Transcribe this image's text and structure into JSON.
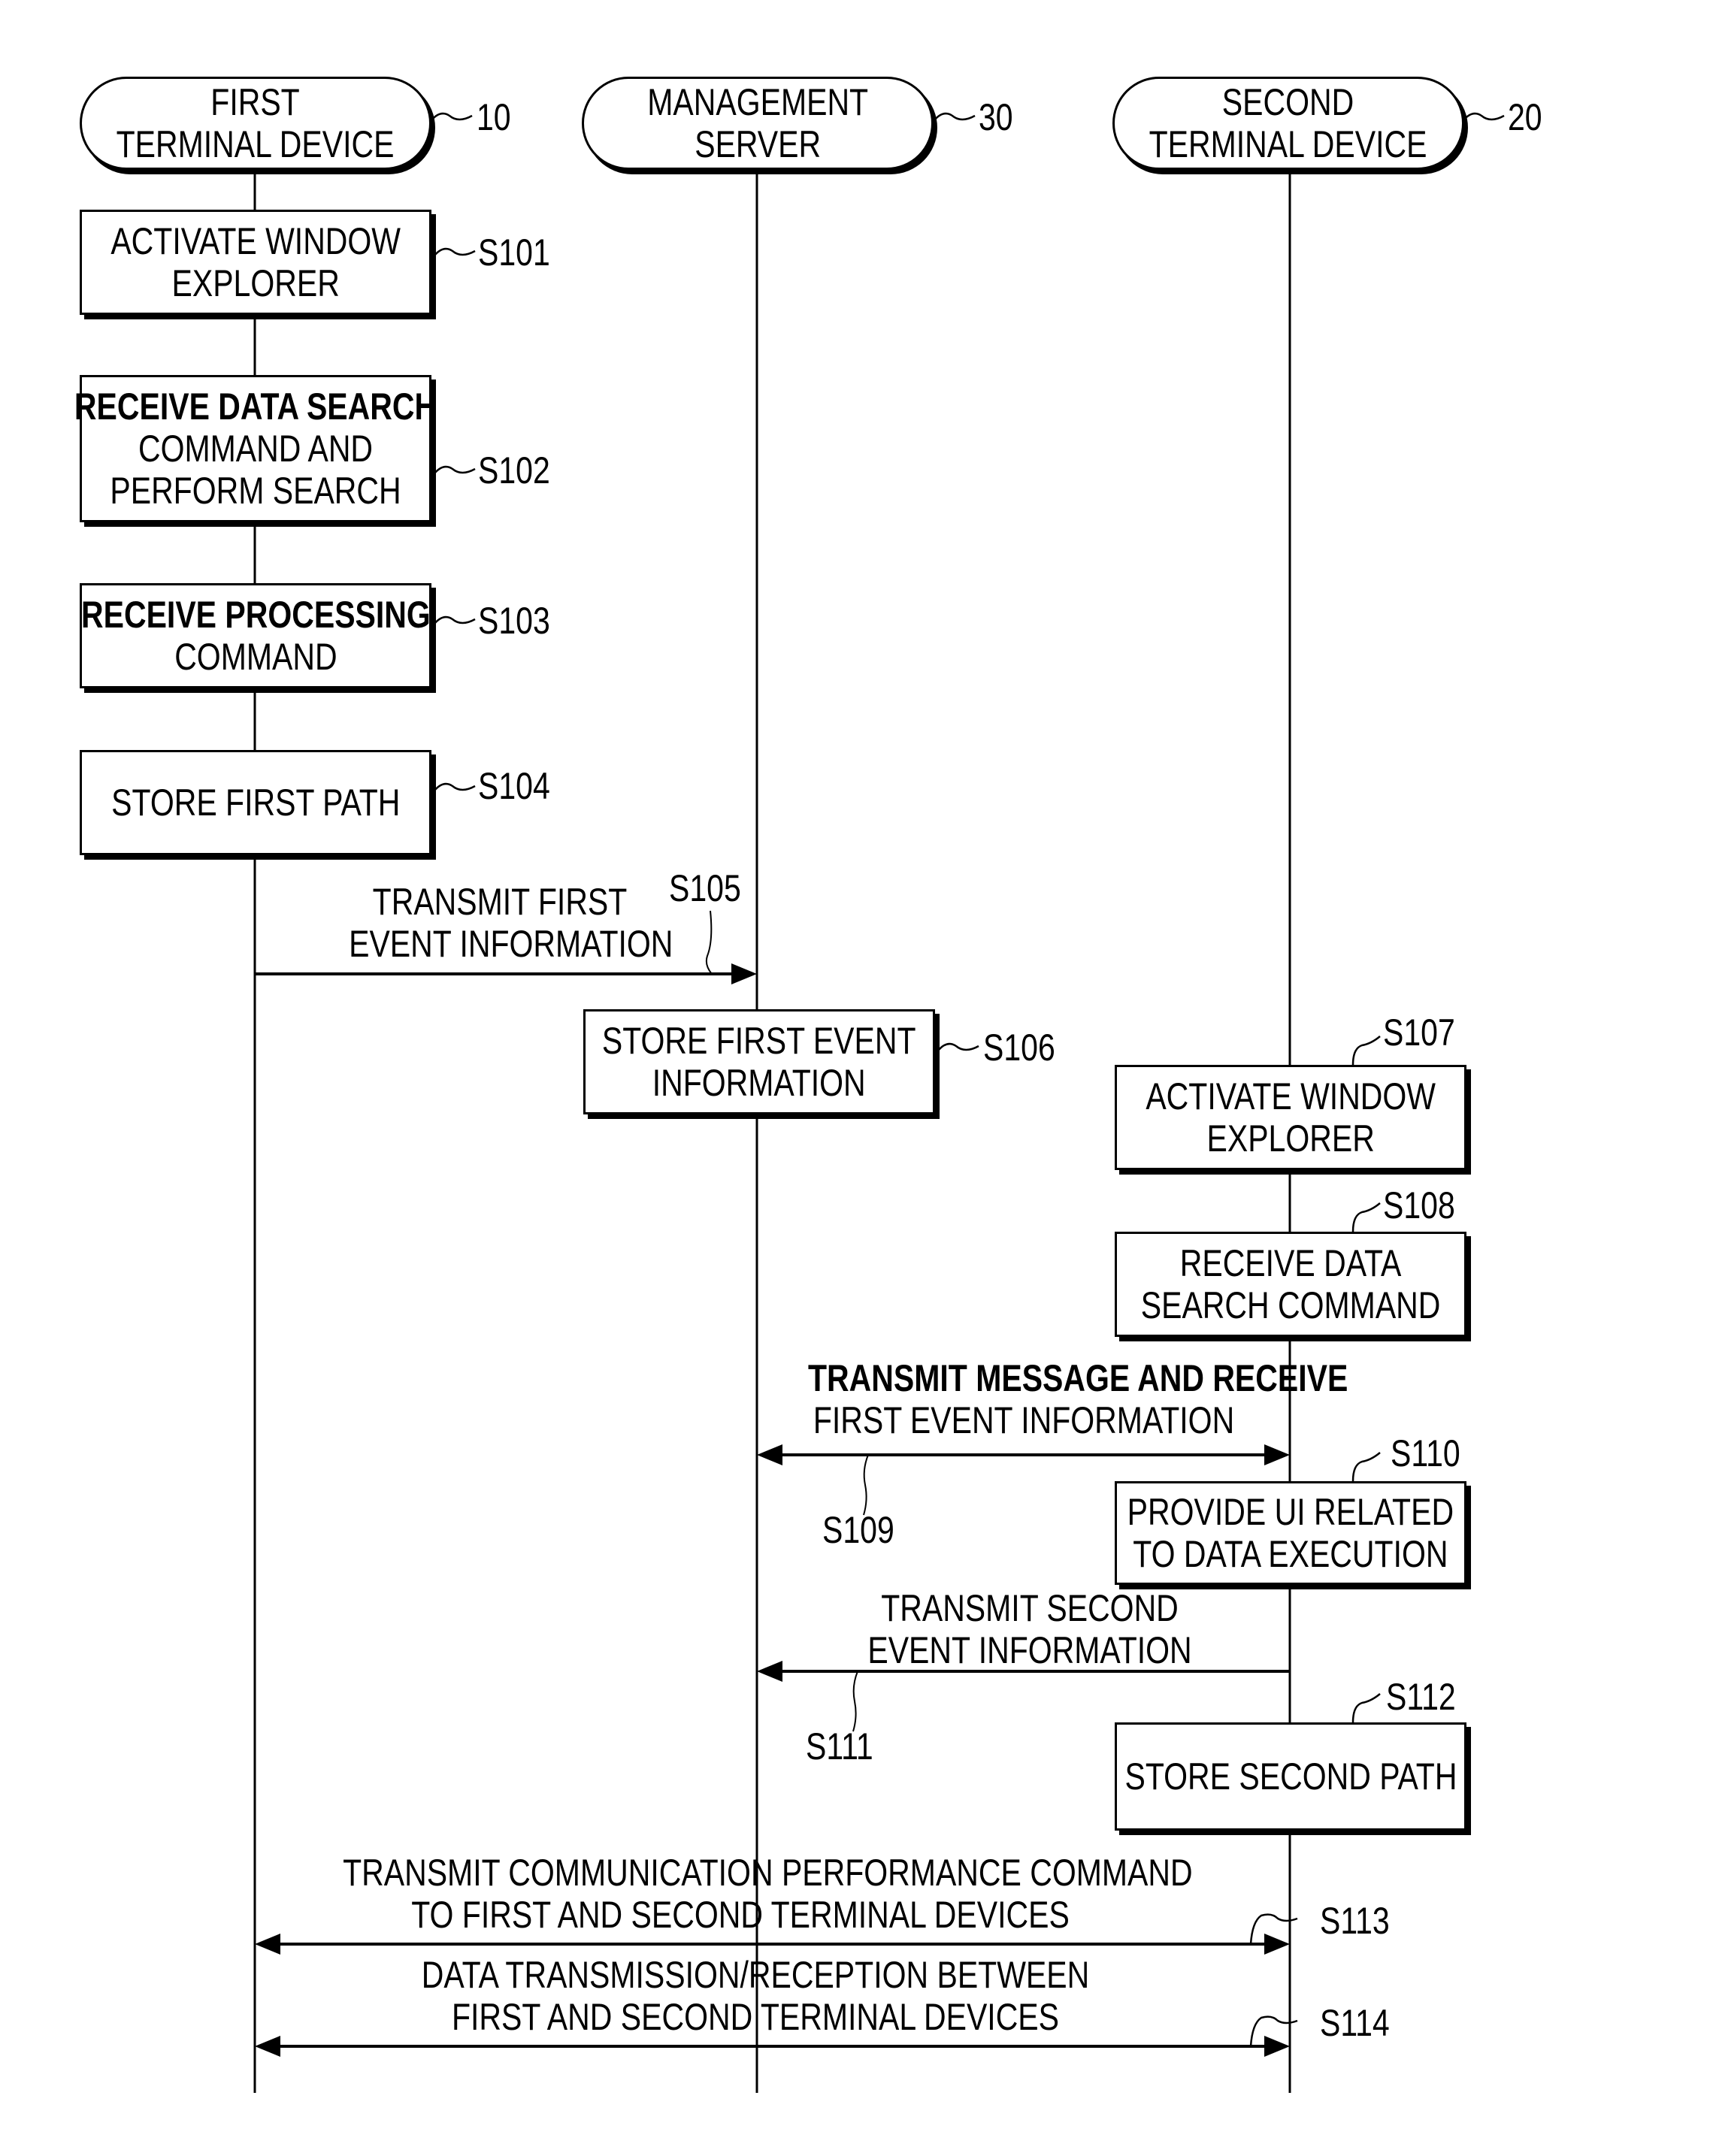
{
  "participants": [
    {
      "id": "first",
      "lines": [
        "FIRST",
        "TERMINAL DEVICE"
      ],
      "ref": "10"
    },
    {
      "id": "server",
      "lines": [
        "MANAGEMENT",
        "SERVER"
      ],
      "ref": "30"
    },
    {
      "id": "second",
      "lines": [
        "SECOND",
        "TERMINAL DEVICE"
      ],
      "ref": "20"
    }
  ],
  "steps": [
    {
      "id": "S101",
      "type": "process",
      "lane": "first",
      "lines": [
        "ACTIVATE WINDOW",
        "EXPLORER"
      ]
    },
    {
      "id": "S102",
      "type": "process",
      "lane": "first",
      "lines": [
        "RECEIVE DATA SEARCH",
        "COMMAND AND",
        "PERFORM SEARCH"
      ]
    },
    {
      "id": "S103",
      "type": "process",
      "lane": "first",
      "lines": [
        "RECEIVE PROCESSING",
        "COMMAND"
      ]
    },
    {
      "id": "S104",
      "type": "process",
      "lane": "first",
      "lines": [
        "STORE FIRST PATH"
      ]
    },
    {
      "id": "S105",
      "type": "message",
      "from": "first",
      "to": "server",
      "lines": [
        "TRANSMIT FIRST",
        "EVENT INFORMATION"
      ]
    },
    {
      "id": "S106",
      "type": "process",
      "lane": "server",
      "lines": [
        "STORE FIRST EVENT",
        "INFORMATION"
      ]
    },
    {
      "id": "S107",
      "type": "process",
      "lane": "second",
      "lines": [
        "ACTIVATE WINDOW",
        "EXPLORER"
      ]
    },
    {
      "id": "S108",
      "type": "process",
      "lane": "second",
      "lines": [
        "RECEIVE DATA",
        "SEARCH COMMAND"
      ]
    },
    {
      "id": "S109",
      "type": "message",
      "from": "server",
      "to": "second",
      "bidirectional": true,
      "lines": [
        "TRANSMIT MESSAGE AND RECEIVE",
        "FIRST EVENT INFORMATION"
      ]
    },
    {
      "id": "S110",
      "type": "process",
      "lane": "second",
      "lines": [
        "PROVIDE UI RELATED",
        "TO DATA EXECUTION"
      ]
    },
    {
      "id": "S111",
      "type": "message",
      "from": "second",
      "to": "server",
      "lines": [
        "TRANSMIT SECOND",
        "EVENT INFORMATION"
      ]
    },
    {
      "id": "S112",
      "type": "process",
      "lane": "second",
      "lines": [
        "STORE SECOND PATH"
      ]
    },
    {
      "id": "S113",
      "type": "message",
      "from": "first",
      "to": "second",
      "bidirectional": true,
      "lines": [
        "TRANSMIT COMMUNICATION PERFORMANCE COMMAND",
        "TO FIRST AND SECOND TERMINAL DEVICES"
      ]
    },
    {
      "id": "S114",
      "type": "message",
      "from": "first",
      "to": "second",
      "bidirectional": true,
      "lines": [
        "DATA TRANSMISSION/RECEPTION BETWEEN",
        "FIRST AND SECOND TERMINAL DEVICES"
      ]
    }
  ]
}
